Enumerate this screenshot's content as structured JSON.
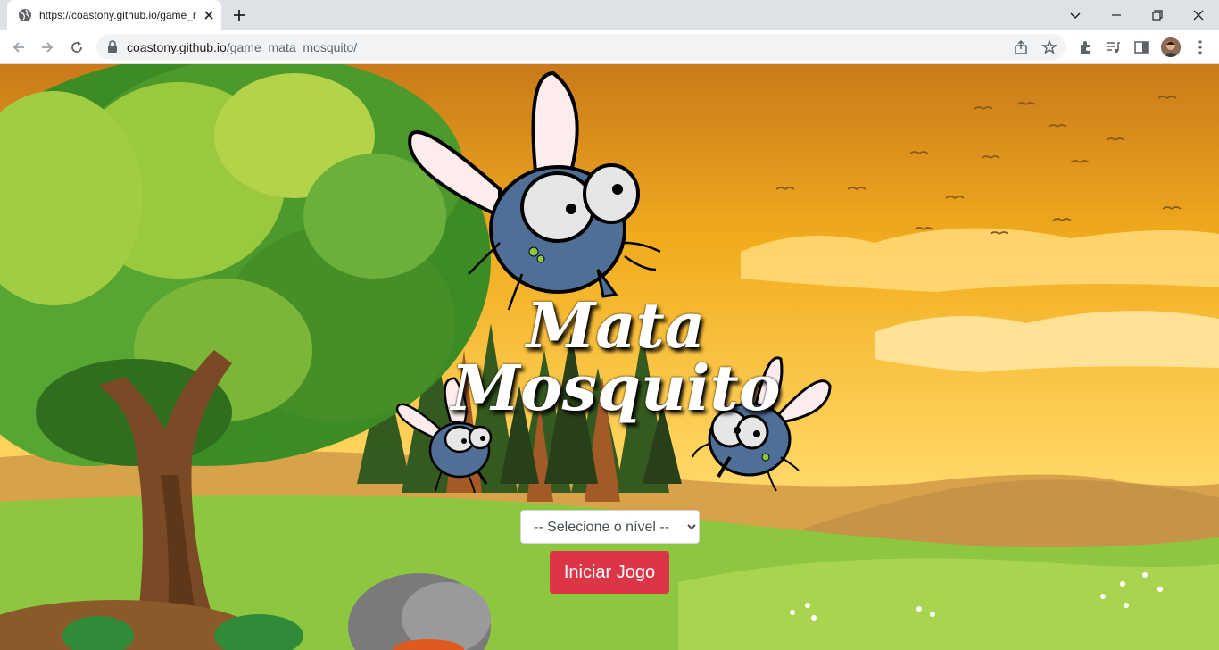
{
  "browser": {
    "tab_title": "https://coastony.github.io/game_mata_mosquito/",
    "url_host": "coastony.github.io",
    "url_path": "/game_mata_mosquito/"
  },
  "game": {
    "title_line1": "Mata",
    "title_line2": "Mosquito",
    "level_placeholder": "-- Selecione o nível --",
    "start_label": "Iniciar Jogo"
  },
  "colors": {
    "start_button": "#dc3545",
    "sky_top": "#c97a1a",
    "sky_bottom": "#ffe08a",
    "grass": "#8dc63f"
  }
}
